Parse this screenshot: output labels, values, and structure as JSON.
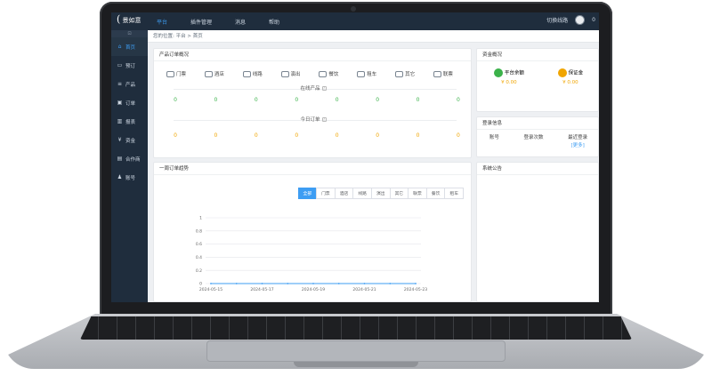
{
  "app": {
    "logo_text": "景如意",
    "logo_mark": "("
  },
  "nav": {
    "items": [
      "平台",
      "插件管理",
      "消息",
      "帮助"
    ],
    "switch_label": "切换线路",
    "user_count": "0"
  },
  "sidebar": {
    "collapse_icon": "⊡",
    "items": [
      {
        "icon": "home-icon",
        "glyph": "⌂",
        "label": "首页"
      },
      {
        "icon": "cart-icon",
        "glyph": "▭",
        "label": "预订"
      },
      {
        "icon": "list-icon",
        "glyph": "≡",
        "label": "产品"
      },
      {
        "icon": "order-icon",
        "glyph": "▣",
        "label": "订单"
      },
      {
        "icon": "chart-icon",
        "glyph": "▥",
        "label": "报表"
      },
      {
        "icon": "yen-icon",
        "glyph": "¥",
        "label": "资金"
      },
      {
        "icon": "partner-icon",
        "glyph": "▤",
        "label": "合作商"
      },
      {
        "icon": "user-icon",
        "glyph": "♟",
        "label": "账号"
      }
    ]
  },
  "breadcrumb": "您的位置:  平台 > 首页",
  "product_panel": {
    "title": "产品订单概况",
    "categories": [
      "门票",
      "酒店",
      "线路",
      "演出",
      "餐饮",
      "租车",
      "其它",
      "联票"
    ],
    "online_label": "在线产品",
    "online_values": [
      "0",
      "0",
      "0",
      "0",
      "0",
      "0",
      "0",
      "0"
    ],
    "today_label": "今日订单",
    "today_values": [
      "0",
      "0",
      "0",
      "0",
      "0",
      "0",
      "0",
      "0"
    ]
  },
  "funds_panel": {
    "title": "资金概况",
    "items": [
      {
        "label": "平台余额",
        "amount": "¥ 0.00",
        "color": "#3bb24a"
      },
      {
        "label": "保证金",
        "amount": "¥ 0.00",
        "color": "#f0a500"
      }
    ]
  },
  "login_panel": {
    "title": "登录信息",
    "cols": [
      "账号",
      "登录次数",
      "最近登录"
    ],
    "more_label": "[更多]"
  },
  "trend_panel": {
    "title": "一周订单趋势",
    "filters": [
      "全部",
      "门票",
      "酒店",
      "线路",
      "演出",
      "其它",
      "联票",
      "餐饮",
      "租车"
    ],
    "active_filter": "全部"
  },
  "notice_panel": {
    "title": "系统公告"
  },
  "chart_data": {
    "type": "line",
    "x": [
      "2024-05-15",
      "2024-05-16",
      "2024-05-17",
      "2024-05-18",
      "2024-05-19",
      "2024-05-20",
      "2024-05-21",
      "2024-05-22",
      "2024-05-23"
    ],
    "x_tick_labels": [
      "2024-05-15",
      "2024-05-17",
      "2024-05-19",
      "2024-05-21",
      "2024-05-23"
    ],
    "series": [
      {
        "values": [
          0,
          0,
          0,
          0,
          0,
          0,
          0,
          0,
          0
        ],
        "color": "#3d9df3"
      }
    ],
    "ylim": [
      0,
      1
    ],
    "y_ticks": [
      "0",
      "0.2",
      "0.4",
      "0.6",
      "0.8",
      "1"
    ],
    "grid": true
  }
}
